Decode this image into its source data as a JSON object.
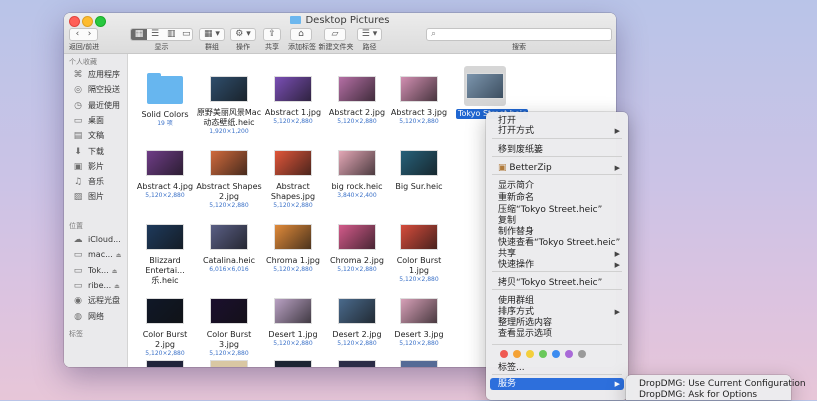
{
  "window": {
    "title": "Desktop Pictures"
  },
  "toolbar": {
    "back_forward_label": "返回/前进",
    "view_label": "显示",
    "group_label": "群组",
    "action_label": "操作",
    "share_label": "共享",
    "tags_label": "添加标签",
    "new_folder_label": "新建文件夹",
    "path_label": "路径",
    "search_label": "搜索"
  },
  "sidebar": {
    "favorites_header": "个人收藏",
    "favorites": [
      {
        "label": "应用程序",
        "icon": "applications-icon"
      },
      {
        "label": "隔空投送",
        "icon": "airdrop-icon"
      },
      {
        "label": "最近使用",
        "icon": "recents-icon"
      },
      {
        "label": "桌面",
        "icon": "desktop-icon"
      },
      {
        "label": "文稿",
        "icon": "documents-icon"
      },
      {
        "label": "下载",
        "icon": "downloads-icon"
      },
      {
        "label": "影片",
        "icon": "movies-icon"
      },
      {
        "label": "音乐",
        "icon": "music-icon"
      },
      {
        "label": "图片",
        "icon": "pictures-icon"
      }
    ],
    "locations_header": "位置",
    "locations": [
      {
        "label": "iCloud...",
        "icon": "icloud-icon"
      },
      {
        "label": "mac...",
        "icon": "disk-icon"
      },
      {
        "label": "Tok...",
        "icon": "disk-icon"
      },
      {
        "label": "ribe...",
        "icon": "disk-icon"
      },
      {
        "label": "远程光盘",
        "icon": "remote-disc-icon"
      },
      {
        "label": "网络",
        "icon": "network-icon"
      }
    ],
    "tags_header": "标签"
  },
  "files": [
    {
      "name": "Solid Colors",
      "meta": "19 项",
      "type": "folder"
    },
    {
      "name": "原野美丽风景Mac动态壁纸.heic",
      "meta": "1,920×1,200",
      "color": "#2f4e6c"
    },
    {
      "name": "Abstract 1.jpg",
      "meta": "5,120×2,880",
      "color": "#7a4fb5"
    },
    {
      "name": "Abstract 2.jpg",
      "meta": "5,120×2,880",
      "color": "#b56fa5"
    },
    {
      "name": "Abstract 3.jpg",
      "meta": "5,120×2,880",
      "color": "#d28fb2"
    },
    {
      "name": "Abstract 4.jpg",
      "meta": "5,120×2,880",
      "color": "#6f3d87"
    },
    {
      "name": "Abstract Shapes 2.jpg",
      "meta": "5,120×2,880",
      "color": "#d06a3c"
    },
    {
      "name": "Abstract Shapes.jpg",
      "meta": "5,120×2,880",
      "color": "#e0563a"
    },
    {
      "name": "big rock.heic",
      "meta": "3,840×2,400",
      "color": "#e3a7b6"
    },
    {
      "name": "Big Sur.heic",
      "meta": "",
      "color": "#27617a"
    },
    {
      "name": "Blizzard Entertai...乐.heic",
      "meta": "",
      "color": "#1e3a5c"
    },
    {
      "name": "Catalina.heic",
      "meta": "6,016×6,016",
      "color": "#5a5f85"
    },
    {
      "name": "Chroma 1.jpg",
      "meta": "5,120×2,880",
      "color": "#e08a3a"
    },
    {
      "name": "Chroma 2.jpg",
      "meta": "5,120×2,880",
      "color": "#d35a8a"
    },
    {
      "name": "Color Burst 1.jpg",
      "meta": "5,120×2,880",
      "color": "#d64c3c"
    },
    {
      "name": "Color Burst 2.jpg",
      "meta": "5,120×2,880",
      "color": "#101828"
    },
    {
      "name": "Color Burst 3.jpg",
      "meta": "5,120×2,880",
      "color": "#1b0f2e"
    },
    {
      "name": "Desert 1.jpg",
      "meta": "5,120×2,880",
      "color": "#b9a1c3"
    },
    {
      "name": "Desert 2.jpg",
      "meta": "5,120×2,880",
      "color": "#4a6a8c"
    },
    {
      "name": "Desert 3.jpg",
      "meta": "5,120×2,880",
      "color": "#d7a0b8"
    }
  ],
  "selected_file": {
    "label": "Tokyo Street.heic",
    "color": "#7c95ad"
  },
  "partial_row_colors": [
    "#20243a",
    "#d9c7a3",
    "#1d2533",
    "#2b2d47",
    "#556b96"
  ],
  "context_menu": {
    "open": "打开",
    "open_with": "打开方式",
    "move_to_trash": "移到废纸篓",
    "betterzip": "BetterZip",
    "get_info": "显示简介",
    "rename": "重新命名",
    "compress": "压缩“Tokyo Street.heic”",
    "duplicate": "复制",
    "make_alias": "制作替身",
    "quick_look": "快速查看“Tokyo Street.heic”",
    "share": "共享",
    "quick_actions": "快速操作",
    "copy": "拷贝“Tokyo Street.heic”",
    "use_groups": "使用群组",
    "sort_by": "排序方式",
    "clean_up": "整理所选内容",
    "show_view_options": "查看显示选项",
    "tags": "标签...",
    "services": "服务",
    "tag_colors": [
      "#ef5a52",
      "#f4a235",
      "#f3cf3c",
      "#6ac85a",
      "#3c8cf0",
      "#a96ad8",
      "#9a9a9a"
    ]
  },
  "services_submenu": {
    "item1": "DropDMG: Use Current Configuration",
    "item2": "DropDMG: Ask for Options"
  }
}
